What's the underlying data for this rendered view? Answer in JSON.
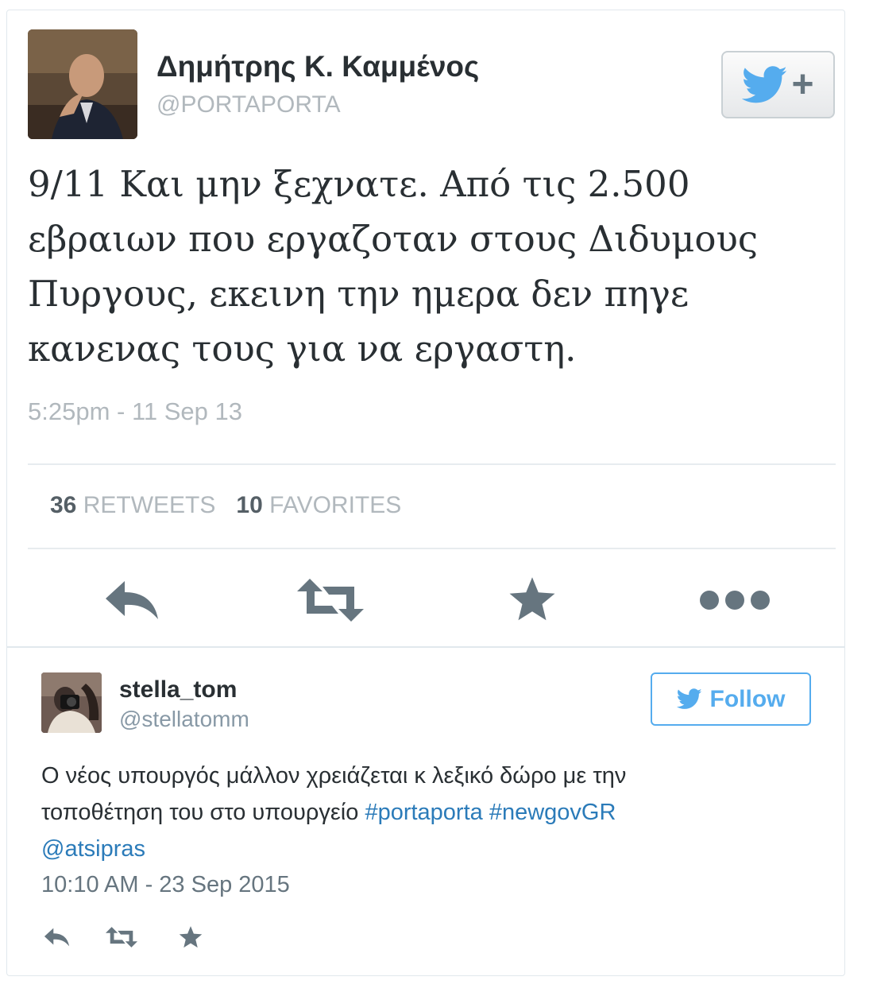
{
  "tweet1": {
    "author_name": "Δημήτρης Κ. Καμμένος",
    "author_handle": "@PORTAPORTA",
    "text_lines": [
      "9/11 Και μην ξεχνατε. Από τις 2.500",
      "εβραιων που εργαζοταν στους Διδυμους",
      "Πυργους, εκεινη την ημερα δεν πηγε",
      "κανενας τους για να εργαστη."
    ],
    "timestamp": "5:25pm - 11 Sep 13",
    "retweets_count": "36",
    "retweets_label": "RETWEETS",
    "favorites_count": "10",
    "favorites_label": "FAVORITES",
    "follow_plus_label": "+",
    "actions": [
      "reply-icon",
      "retweet-icon",
      "favorite-star-icon",
      "more-dots-icon"
    ]
  },
  "tweet2": {
    "author_name": "stella_tom",
    "author_handle": "@stellatomm",
    "follow_label": "Follow",
    "text_line1": "Ο νέος υπουργός μάλλον χρειάζεται κ λεξικό δώρο με την",
    "text_line2_plain": "τοποθέτηση του στο υπουργείο ",
    "hashtag1": "#portaporta",
    "hashtag2": "#newgovGR",
    "mention": "@atsipras",
    "timestamp": "10:10 AM - 23 Sep 2015",
    "actions": [
      "reply-icon",
      "retweet-icon",
      "favorite-star-icon"
    ]
  },
  "colors": {
    "twitter_blue": "#55acee",
    "link_blue": "#2b7bb9",
    "muted_gray": "#b1b8bd",
    "icon_gray": "#66757f",
    "border": "#e1e8ed"
  }
}
